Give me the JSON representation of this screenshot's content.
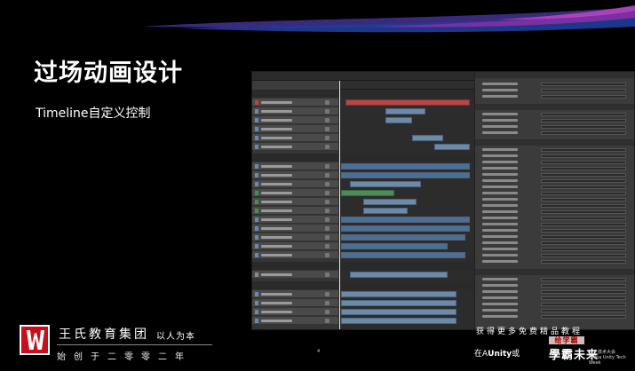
{
  "slide": {
    "title": "过场动画设计",
    "subtitle": "Timeline自定义控制",
    "page_number": "4"
  },
  "branding": {
    "organization": "王氏教育集团",
    "motto": "以人为本",
    "tagline": "始创于二零零二年"
  },
  "promo": {
    "headline": "获得更多免费精品教程",
    "stamp": "给学霸",
    "sub_prefix": "在A",
    "brand": "Unity",
    "sub_suffix": "或",
    "big": "學霸未来",
    "small_line1": "线上技术大会",
    "small_line2": "China Unity Tech Week"
  },
  "editor_window": {
    "timeline_tab": "Timeline",
    "inspector_tab": "Inspector",
    "groups": [
      "camera",
      "player",
      "ghost",
      "FreeRoaming"
    ],
    "inspector_sections": [
      "Transform",
      "Playable Director",
      "Bindings",
      "Animator"
    ]
  },
  "colors": {
    "accent_red": "#c8101a",
    "clip_blue": "#6f8aa6",
    "clip_red": "#b54747",
    "clip_green": "#4f8a5a",
    "swoosh_purple": "#6a2c8f",
    "swoosh_blue": "#2a4fb0"
  }
}
